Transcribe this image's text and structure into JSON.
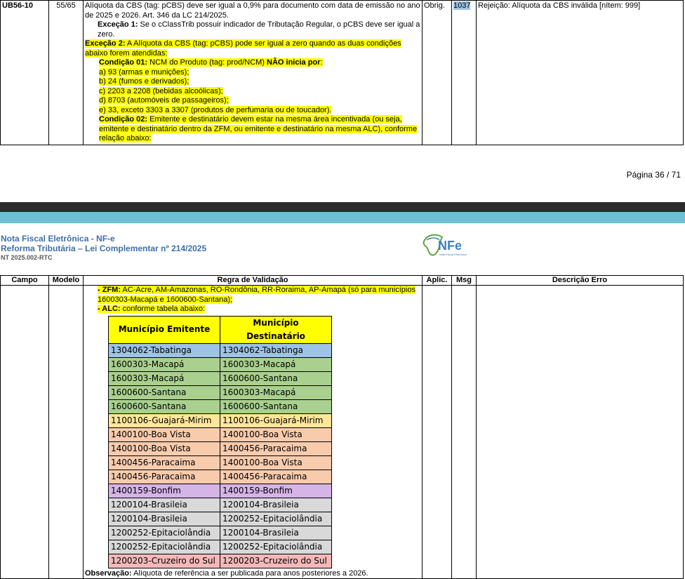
{
  "top_row": {
    "campo": "UB56-10",
    "modelo": "55/65",
    "regra": {
      "p1": "Alíquota da CBS (tag: pCBS) deve ser igual a 0,9% para documento com data de emissão no ano de 2025 e 2026. Art. 346 da LC 214/2025.",
      "exc1_label": "Exceção 1:",
      "exc1_text": " Se o cClassTrib possuir indicador de Tributação Regular, o pCBS deve ser igual a zero.",
      "exc2_label": "Exceção 2:",
      "exc2_text": " A Alíquota da CBS (tag: pCBS) pode ser igual a zero quando as duas condições abaixo forem atendidas:",
      "cond1_label": "Condição 01:",
      "cond1_text": " NCM do Produto (tag: prod/NCM) ",
      "cond1_bold": "NÃO inicia por",
      "cond1_end": ":",
      "items": [
        "a) 93 (armas e munições);",
        "b) 24 (fumos e derivados);",
        "c) 2203 a 2208 (bebidas alcoólicas);",
        "d) 8703 (automóveis de passageiros);",
        "e) 33, exceto 3303 a 3307 (produtos de perfumaria ou de toucador)."
      ],
      "cond2_label": "Condição 02:",
      "cond2_text": " Emitente e destinatário devem estar na mesma área incentivada (ou seja, emitente e destinatário dentro da ZFM, ou emitente e destinatário na mesma ALC), conforme relação abaixo:"
    },
    "aplic": "Obrig.",
    "msg": "1037",
    "descricao": "Rejeição: Alíquota da CBS inválida [nItem: 999]"
  },
  "page_number": "Página 36 / 71",
  "header": {
    "title1": "Nota Fiscal Eletrônica - NF-e",
    "title2": "Reforma Tributária – Lei Complementar nº 214/2025",
    "subtitle": "NT 2025.002-RTC",
    "logo_text": "NFe",
    "logo_sub": "Nota Fiscal Eletrônica"
  },
  "columns": {
    "campo": "Campo",
    "modelo": "Modelo",
    "regra": "Regra de Validação",
    "aplic": "Aplic.",
    "msg": "Msg",
    "descricao": "Descrição Erro"
  },
  "bottom_row": {
    "zfm_label": "- ZFM:",
    "zfm_text": " AC-Acre, AM-Amazonas, RO-Rondônia, RR-Roraima, AP-Amapá (só para municípios 1600303-Macapá e 1600600-Santana);",
    "alc_label": "- ALC:",
    "alc_text": " conforme tabela abaixo:",
    "obs_label": "Observação:",
    "obs_text": " Alíquota de referência a ser publicada para anos posteriores a 2026."
  },
  "municipios": {
    "headers": [
      "Município Emitente",
      "Município Destinatário"
    ],
    "rows": [
      {
        "emit": "1304062-Tabatinga",
        "dest": "1304062-Tabatinga",
        "color": "#9dc3e6"
      },
      {
        "emit": "1600303-Macapá",
        "dest": "1600303-Macapá",
        "color": "#a9d08e"
      },
      {
        "emit": "1600303-Macapá",
        "dest": "1600600-Santana",
        "color": "#a9d08e"
      },
      {
        "emit": "1600600-Santana",
        "dest": "1600303-Macapá",
        "color": "#a9d08e"
      },
      {
        "emit": "1600600-Santana",
        "dest": "1600600-Santana",
        "color": "#a9d08e"
      },
      {
        "emit": "1100106-Guajará-Mirim",
        "dest": "1100106-Guajará-Mirim",
        "color": "#ffe699"
      },
      {
        "emit": "1400100-Boa Vista",
        "dest": "1400100-Boa Vista",
        "color": "#f8cbad"
      },
      {
        "emit": "1400100-Boa Vista",
        "dest": "1400456-Paracaima",
        "color": "#f8cbad"
      },
      {
        "emit": "1400456-Paracaima",
        "dest": "1400100-Boa Vista",
        "color": "#f8cbad"
      },
      {
        "emit": "1400456-Paracaima",
        "dest": "1400456-Paracaima",
        "color": "#f8cbad"
      },
      {
        "emit": "1400159-Bonfim",
        "dest": "1400159-Bonfim",
        "color": "#d5b4e6"
      },
      {
        "emit": "1200104-Brasileia",
        "dest": "1200104-Brasileia",
        "color": "#d9d9d9"
      },
      {
        "emit": "1200104-Brasileia",
        "dest": "1200252-Epitaciolândia",
        "color": "#d9d9d9"
      },
      {
        "emit": "1200252-Epitaciolândia",
        "dest": "1200104-Brasileia",
        "color": "#d9d9d9"
      },
      {
        "emit": "1200252-Epitaciolândia",
        "dest": "1200252-Epitaciolândia",
        "color": "#d9d9d9"
      },
      {
        "emit": "1200203-Cruzeiro do Sul",
        "dest": "1200203-Cruzeiro do Sul",
        "color": "#f4b8b8"
      }
    ]
  }
}
